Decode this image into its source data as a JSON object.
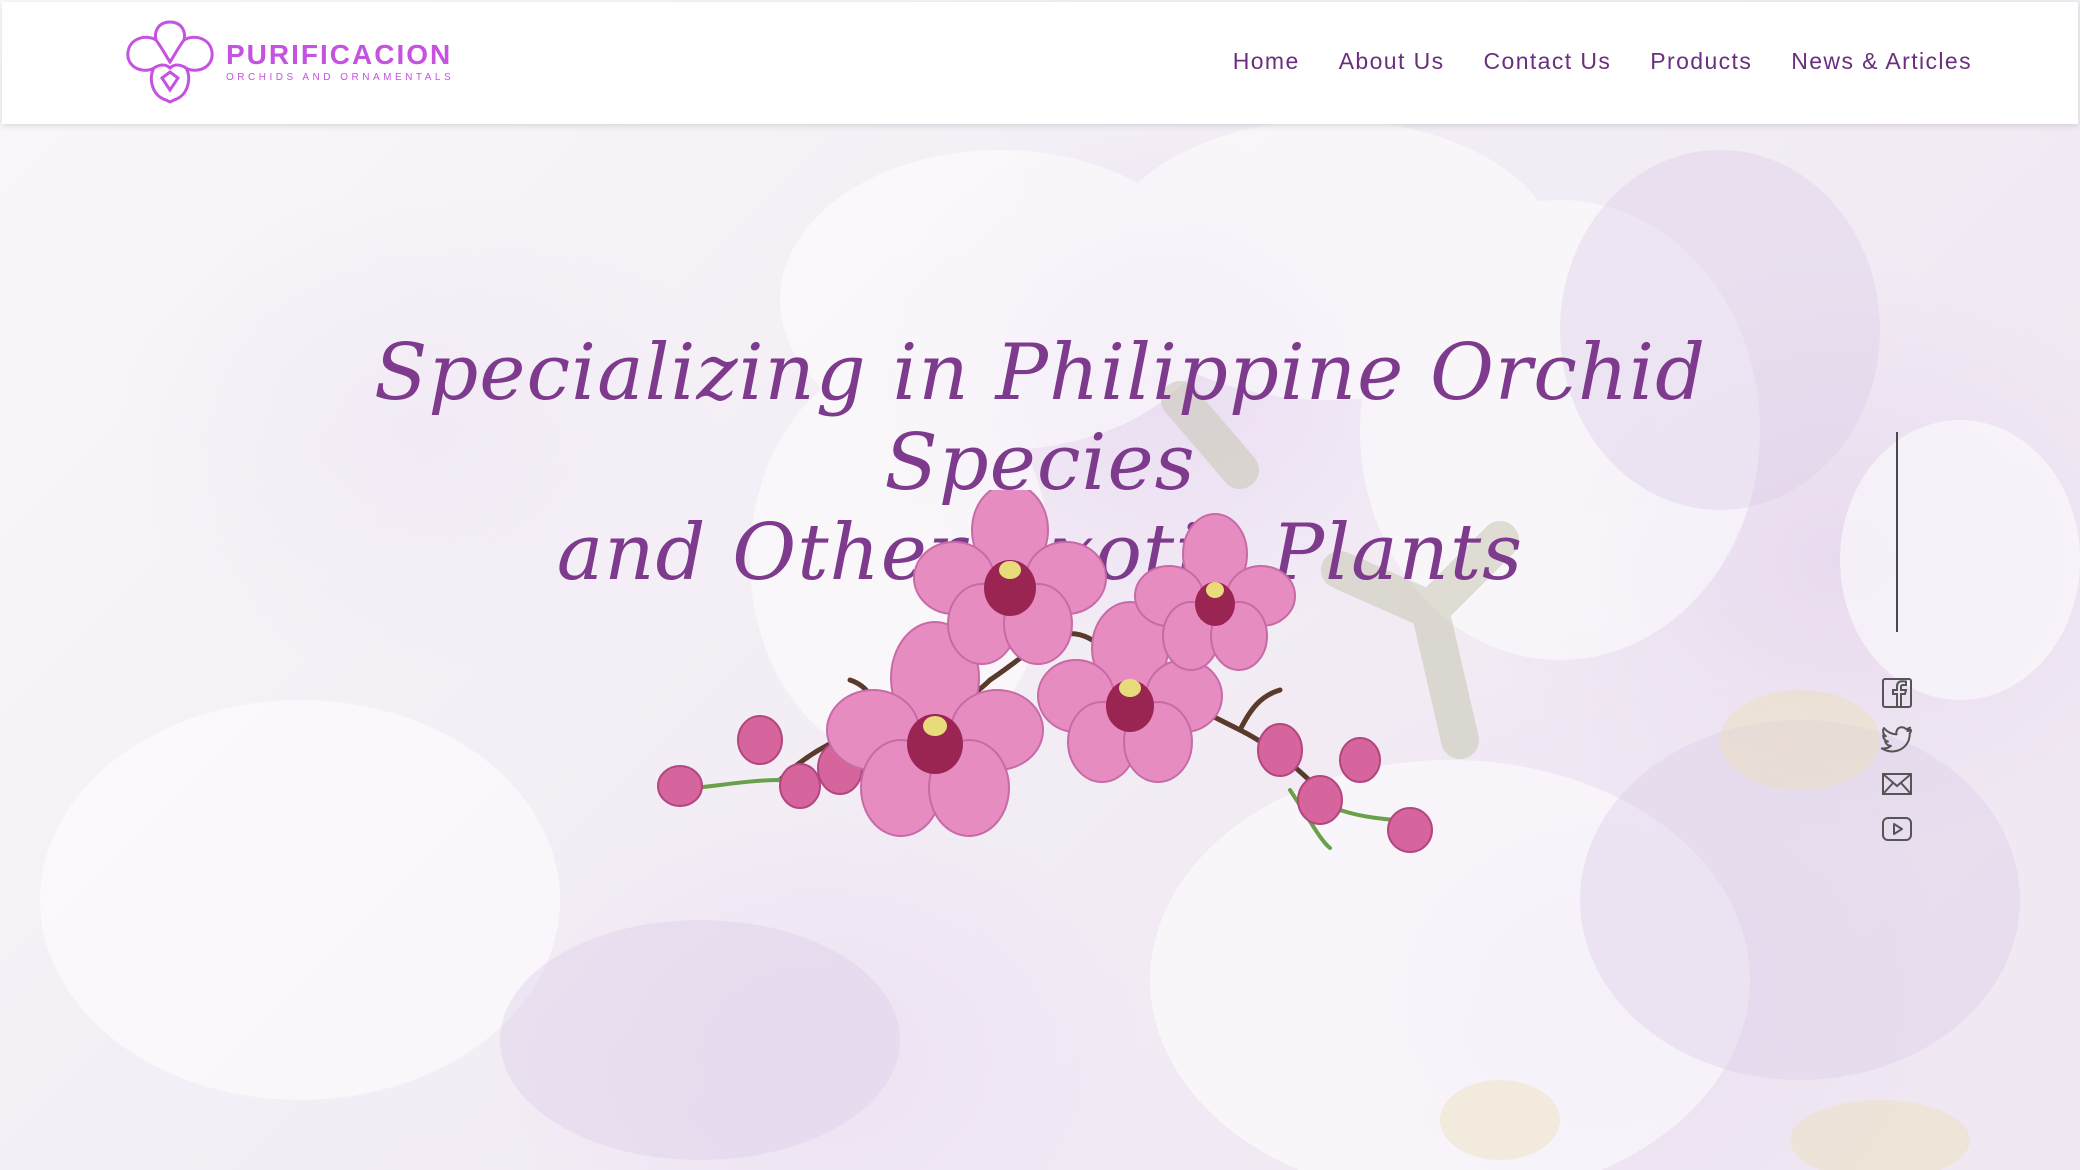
{
  "brand": {
    "name": "PURIFICACION",
    "tagline": "ORCHIDS AND ORNAMENTALS",
    "color": "#c552e0"
  },
  "nav": {
    "items": [
      {
        "label": "Home"
      },
      {
        "label": "About Us"
      },
      {
        "label": "Contact Us"
      },
      {
        "label": "Products"
      },
      {
        "label": "News & Articles"
      }
    ],
    "color": "#6a2f7d"
  },
  "hero": {
    "line1": "Specializing in Philippine Orchid Species",
    "line2": "and Other Exotic Plants",
    "color": "#7e3a8c",
    "image": "pink-orchid-spray-illustration"
  },
  "social": {
    "icons": [
      "facebook-icon",
      "twitter-icon",
      "email-icon",
      "youtube-icon"
    ]
  }
}
